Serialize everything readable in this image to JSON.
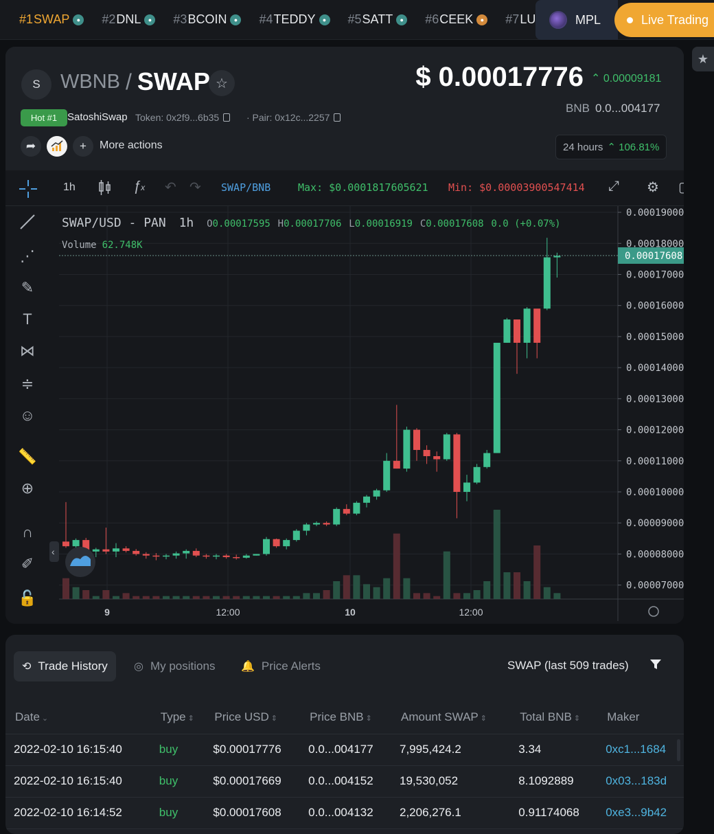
{
  "ticker": [
    {
      "rank": "#1",
      "symbol": "SWAP",
      "active": true
    },
    {
      "rank": "#2",
      "symbol": "DNL"
    },
    {
      "rank": "#3",
      "symbol": "BCOIN"
    },
    {
      "rank": "#4",
      "symbol": "TEDDY"
    },
    {
      "rank": "#5",
      "symbol": "SATT"
    },
    {
      "rank": "#6",
      "symbol": "CEEK"
    },
    {
      "rank": "#7",
      "symbol": "LUS"
    }
  ],
  "mpl_label": "MPL",
  "live_label": "Live Trading",
  "header": {
    "avatar_letter": "S",
    "base": "WBNB",
    "separator": "/",
    "quote": "SWAP",
    "hot_badge": "Hot #1",
    "dex": "SatoshiSwap",
    "token_addr": "Token: 0x2f9...6b35",
    "pair_addr": "· Pair: 0x12c...2257",
    "more_actions": "More actions",
    "price_usd": "$ 0.00017776",
    "price_change": "0.00009181",
    "bnb_label": "BNB",
    "price_bnb": "0.0...004177",
    "range_label": "24 hours",
    "range_change": "106.81%",
    "colors": {
      "up": "#3fbf6a",
      "down": "#e25050",
      "accent": "#f0a732"
    }
  },
  "toolbar": {
    "interval": "1h",
    "pair": "SWAP/BNB",
    "max": "Max: $0.0001817605621",
    "min": "Min: $0.00003900547414"
  },
  "legend": {
    "title": "SWAP/USD - PAN",
    "interval": "1h",
    "o_label": "O",
    "o": "0.00017595",
    "h_label": "H",
    "h": "0.00017706",
    "l_label": "L",
    "l": "0.00016919",
    "c_label": "C",
    "c": "0.00017608",
    "chg": "0.0 (+0.07%)",
    "volume_label": "Volume",
    "volume": "62.748K"
  },
  "chart_data": {
    "type": "candlestick",
    "y_ticks": [
      "0.00019000",
      "0.00018000",
      "0.00017000",
      "0.00016000",
      "0.00015000",
      "0.00014000",
      "0.00013000",
      "0.00012000",
      "0.00011000",
      "0.00010000",
      "0.00009000",
      "0.00008000",
      "0.00007000"
    ],
    "x_ticks": [
      "9",
      "12:00",
      "10",
      "12:00"
    ],
    "last_price": "0.00017608",
    "ylim": [
      6.55e-05,
      0.000192
    ],
    "candles": [
      [
        8.4e-05,
        9.67e-05,
        8.2e-05,
        8.25e-05
      ],
      [
        8.25e-05,
        8.5e-05,
        8e-05,
        8.45e-05
      ],
      [
        8.45e-05,
        8.52e-05,
        7.95e-05,
        8.08e-05
      ],
      [
        8.08e-05,
        8.2e-05,
        7.9e-05,
        8.15e-05
      ],
      [
        8.15e-05,
        8.85e-05,
        8e-05,
        8.08e-05
      ],
      [
        8.08e-05,
        8.35e-05,
        7.9e-05,
        8.18e-05
      ],
      [
        8.18e-05,
        8.25e-05,
        8.05e-05,
        8.1e-05
      ],
      [
        8.1e-05,
        8.16e-05,
        7.95e-05,
        8e-05
      ],
      [
        8e-05,
        8.06e-05,
        7.85e-05,
        7.95e-05
      ],
      [
        7.95e-05,
        8.03e-05,
        7.8e-05,
        7.92e-05
      ],
      [
        7.92e-05,
        8e-05,
        7.83e-05,
        7.95e-05
      ],
      [
        7.95e-05,
        8.08e-05,
        7.85e-05,
        8.02e-05
      ],
      [
        8.02e-05,
        8.15e-05,
        7.85e-05,
        8.1e-05
      ],
      [
        8.1e-05,
        8.18e-05,
        7.9e-05,
        7.95e-05
      ],
      [
        7.95e-05,
        8e-05,
        7.85e-05,
        7.92e-05
      ],
      [
        7.92e-05,
        8e-05,
        7.83e-05,
        7.95e-05
      ],
      [
        7.95e-05,
        8e-05,
        7.85e-05,
        7.9e-05
      ],
      [
        7.9e-05,
        7.98e-05,
        7.82e-05,
        7.88e-05
      ],
      [
        7.88e-05,
        8e-05,
        7.85e-05,
        7.95e-05
      ],
      [
        7.95e-05,
        8e-05,
        7.95e-05,
        8e-05
      ],
      [
        8e-05,
        8.55e-05,
        7.95e-05,
        8.48e-05
      ],
      [
        8.48e-05,
        8.5e-05,
        8.2e-05,
        8.25e-05
      ],
      [
        8.25e-05,
        8.5e-05,
        8.15e-05,
        8.45e-05
      ],
      [
        8.45e-05,
        8.8e-05,
        8.4e-05,
        8.75e-05
      ],
      [
        8.75e-05,
        9e-05,
        8.6e-05,
        8.95e-05
      ],
      [
        8.95e-05,
        9.05e-05,
        8.9e-05,
        9e-05
      ],
      [
        9e-05,
        9.05e-05,
        8.9e-05,
        8.95e-05
      ],
      [
        8.95e-05,
        9.5e-05,
        8.9e-05,
        9.45e-05
      ],
      [
        9.45e-05,
        9.6e-05,
        9.25e-05,
        9.3e-05
      ],
      [
        9.3e-05,
        9.7e-05,
        9.25e-05,
        9.65e-05
      ],
      [
        9.65e-05,
        9.9e-05,
        9.5e-05,
        9.85e-05
      ],
      [
        9.85e-05,
        0.000101,
        9.75e-05,
        0.0001005
      ],
      [
        0.0001005,
        0.0001125,
        0.0001,
        0.00011
      ],
      [
        0.00011,
        0.000128,
        0.0001075,
        0.0001075
      ],
      [
        0.0001075,
        0.000121,
        0.0001065,
        0.00012
      ],
      [
        0.00012,
        0.0001205,
        0.00011,
        0.0001135
      ],
      [
        0.0001135,
        0.000115,
        0.000109,
        0.0001115
      ],
      [
        0.0001115,
        0.000113,
        0.0001065,
        0.0001105
      ],
      [
        0.0001105,
        0.000119,
        0.00011,
        0.0001185
      ],
      [
        0.0001185,
        0.000119,
        9.15e-05,
        0.0001
      ],
      [
        0.0001,
        0.0001055,
        9.7e-05,
        0.000103
      ],
      [
        0.000103,
        0.000109,
        0.0001025,
        0.000108
      ],
      [
        0.000108,
        0.0001135,
        0.0001075,
        0.0001125
      ],
      [
        0.0001125,
        0.000148,
        0.0001125,
        0.000148
      ],
      [
        0.000148,
        0.000156,
        0.000148,
        0.0001555
      ],
      [
        0.0001555,
        0.0001555,
        0.000138,
        0.000148
      ],
      [
        0.000148,
        0.0001595,
        0.000143,
        0.000159
      ],
      [
        0.000159,
        0.0001585,
        0.000143,
        0.000148
      ],
      [
        0.000159,
        0.0001818,
        0.0001585,
        0.0001755
      ],
      [
        0.0001755,
        0.000177,
        0.000169,
        0.000176
      ]
    ],
    "volumes": [
      7,
      4,
      3,
      1,
      3,
      1,
      2,
      1,
      1,
      1,
      1,
      1,
      1,
      1,
      1,
      1,
      1,
      1,
      1,
      1,
      1,
      1,
      1,
      1,
      2,
      2,
      3,
      6,
      8,
      8,
      5,
      4,
      7,
      22,
      7,
      2,
      2,
      1,
      16,
      2,
      2,
      3,
      6,
      30,
      9,
      9,
      6,
      18,
      4,
      2
    ]
  },
  "trades": {
    "tabs": [
      {
        "icon": "history-icon",
        "label": "Trade History",
        "active": true
      },
      {
        "icon": "target-icon",
        "label": "My positions"
      },
      {
        "icon": "bell-icon",
        "label": "Price Alerts"
      }
    ],
    "count_label": "SWAP (last 509 trades)",
    "columns": [
      "Date",
      "Type",
      "Price USD",
      "Price BNB",
      "Amount SWAP",
      "Total BNB",
      "Maker"
    ],
    "rows": [
      [
        "2022-02-10 16:15:40",
        "buy",
        "$0.00017776",
        "0.0...004177",
        "7,995,424.2",
        "3.34",
        "0xc1...1684"
      ],
      [
        "2022-02-10 16:15:40",
        "buy",
        "$0.00017669",
        "0.0...004152",
        "19,530,052",
        "8.1092889",
        "0x03...183d"
      ],
      [
        "2022-02-10 16:14:52",
        "buy",
        "$0.00017608",
        "0.0...004132",
        "2,206,276.1",
        "0.91174068",
        "0xe3...9b42"
      ]
    ]
  }
}
